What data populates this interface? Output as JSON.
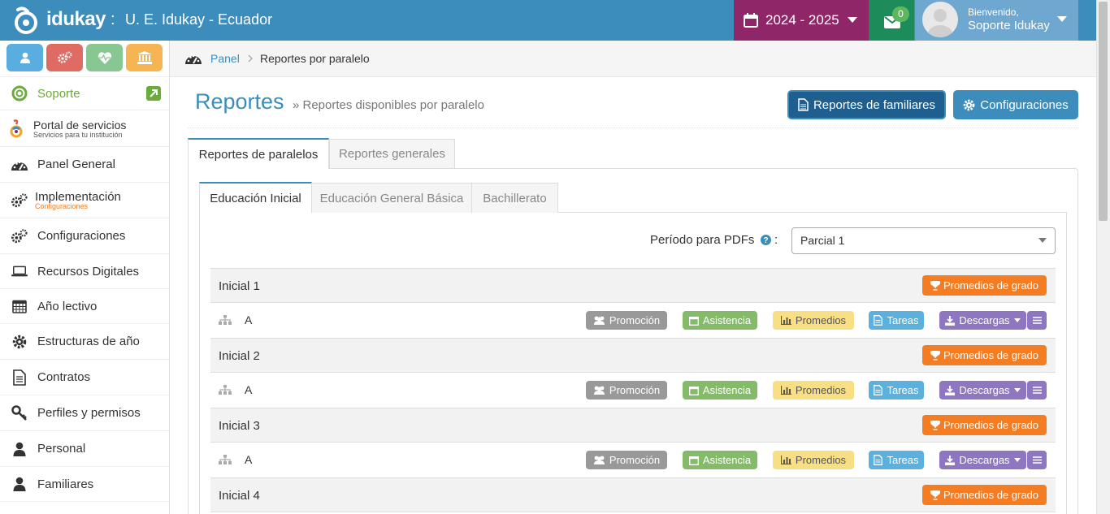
{
  "header": {
    "brand": "idukay",
    "separator": ":",
    "school": "U. E. Idukay - Ecuador",
    "year": "2024 - 2025",
    "unread_count": "0",
    "welcome": "Bienvenido,",
    "user_name": "Soporte Idukay"
  },
  "colors": {
    "header_bg": "#3c8dbc",
    "year_bg": "#8e2668",
    "mail_bg": "#1e8c5a",
    "promedios_grado": "#f47c22"
  },
  "sidebar": {
    "quick_buttons": [
      {
        "icon": "user-icon",
        "color": "#5aaedf"
      },
      {
        "icon": "gears-icon",
        "color": "#e06b63"
      },
      {
        "icon": "heartbeat-icon",
        "color": "#89c792"
      },
      {
        "icon": "institution-icon",
        "color": "#f6b552"
      }
    ],
    "support_label": "Soporte",
    "portal_label": "Portal de servicios",
    "portal_sub": "Servicios para tu institución",
    "items": [
      {
        "label": "Panel General",
        "icon": "dashboard-icon"
      },
      {
        "label": "Implementación",
        "sub": "Configuraciones",
        "icon": "gears-icon"
      },
      {
        "label": "Configuraciones",
        "icon": "gears-icon"
      },
      {
        "label": "Recursos Digitales",
        "icon": "laptop-icon"
      },
      {
        "label": "Año lectivo",
        "icon": "calendar-icon"
      },
      {
        "label": "Estructuras de año",
        "icon": "gear-icon"
      },
      {
        "label": "Contratos",
        "icon": "document-icon"
      },
      {
        "label": "Perfiles y permisos",
        "icon": "key-icon"
      },
      {
        "label": "Personal",
        "icon": "user-icon"
      },
      {
        "label": "Familiares",
        "icon": "user-icon"
      }
    ]
  },
  "breadcrumb": {
    "root": "Panel",
    "current": "Reportes por paralelo"
  },
  "page": {
    "title": "Reportes",
    "subtitle": "» Reportes disponibles por paralelo",
    "btn_familiares": "Reportes de familiares",
    "btn_config": "Configuraciones"
  },
  "tabs": {
    "primary": [
      "Reportes de paralelos",
      "Reportes generales"
    ],
    "secondary": [
      "Educación Inicial",
      "Educación General Básica",
      "Bachillerato"
    ]
  },
  "filter": {
    "label": "Período para PDFs",
    "colon": ":",
    "value": "Parcial 1"
  },
  "groups": [
    {
      "name": "Inicial 1",
      "section": "A"
    },
    {
      "name": "Inicial 2",
      "section": "A"
    },
    {
      "name": "Inicial 3",
      "section": "A"
    },
    {
      "name": "Inicial 4"
    }
  ],
  "actions": {
    "promedios_grado": "Promedios de grado",
    "promocion": "Promoción",
    "asistencia": "Asistencia",
    "promedios": "Promedios",
    "tareas": "Tareas",
    "descargas": "Descargas"
  }
}
